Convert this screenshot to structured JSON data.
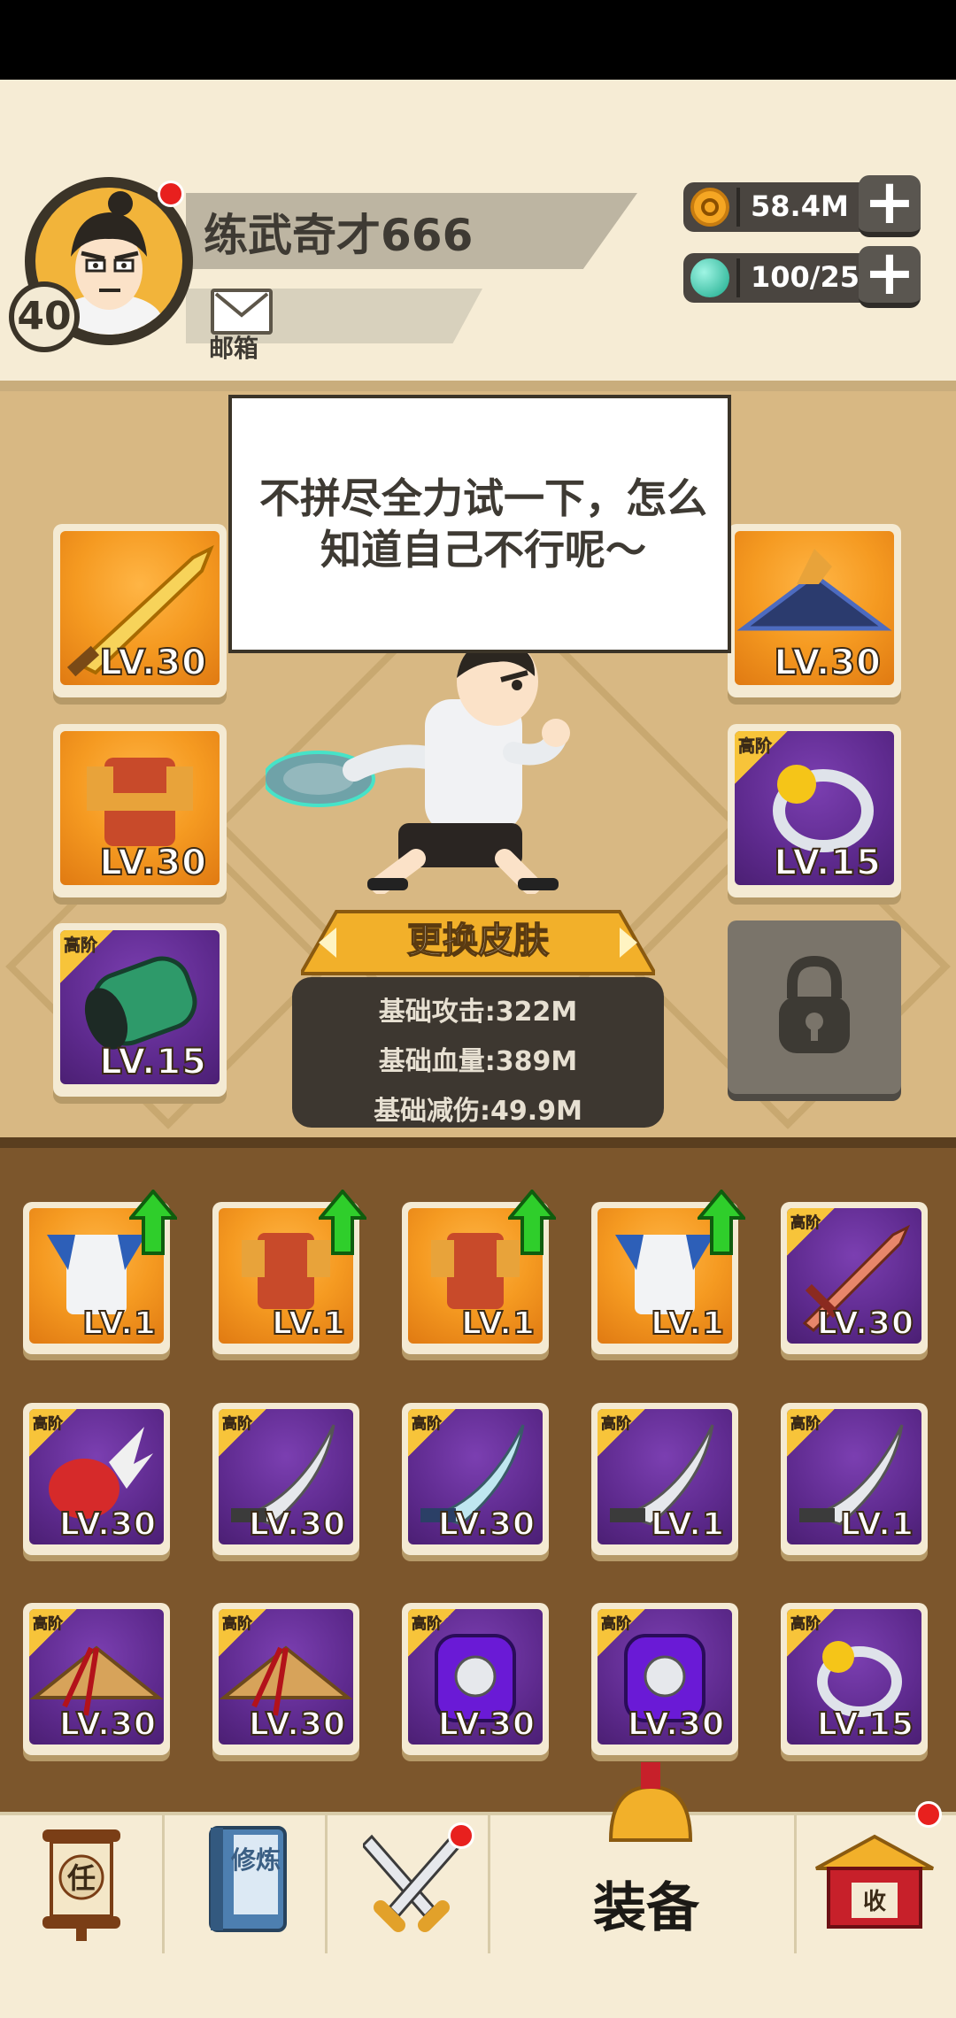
{
  "player": {
    "name": "练武奇才666",
    "level": "40",
    "mail_label": "邮箱"
  },
  "resources": {
    "gold": "58.4M",
    "gems": "100/25"
  },
  "speech": "不拼尽全力试一下，怎么知道自己不行呢～",
  "skin_button": "更换皮肤",
  "stats": {
    "attack": "基础攻击:322M",
    "hp": "基础血量:389M",
    "defense": "基础减伤:49.9M"
  },
  "tier_label": "高阶",
  "equipped": {
    "weapon": "LV.30",
    "armor": "LV.30",
    "bracer": "LV.15",
    "hat": "LV.30",
    "ring": "LV.15"
  },
  "inventory": [
    {
      "level": "LV.1",
      "upgrade": true
    },
    {
      "level": "LV.1",
      "upgrade": true
    },
    {
      "level": "LV.1",
      "upgrade": true
    },
    {
      "level": "LV.1",
      "upgrade": true
    },
    {
      "level": "LV.30",
      "upgrade": false
    },
    {
      "level": "LV.30",
      "upgrade": false
    },
    {
      "level": "LV.30",
      "upgrade": false
    },
    {
      "level": "LV.30",
      "upgrade": false
    },
    {
      "level": "LV.1",
      "upgrade": false
    },
    {
      "level": "LV.1",
      "upgrade": false
    },
    {
      "level": "LV.30",
      "upgrade": false
    },
    {
      "level": "LV.30",
      "upgrade": false
    },
    {
      "level": "LV.30",
      "upgrade": false
    },
    {
      "level": "LV.30",
      "upgrade": false
    },
    {
      "level": "LV.15",
      "upgrade": false
    }
  ],
  "nav": {
    "tasks_icon_text": "任",
    "train_icon_text": "修炼",
    "equip_label": "装备",
    "collect_icon_text": "收"
  },
  "colors": {
    "header_bg": "#f6ecd5",
    "stage_bg": "#d8b883",
    "inventory_bg": "#7c562c",
    "rarity_orange": "#f59a21",
    "rarity_purple": "#5e2a8e",
    "upgrade_green": "#2fce2b"
  }
}
